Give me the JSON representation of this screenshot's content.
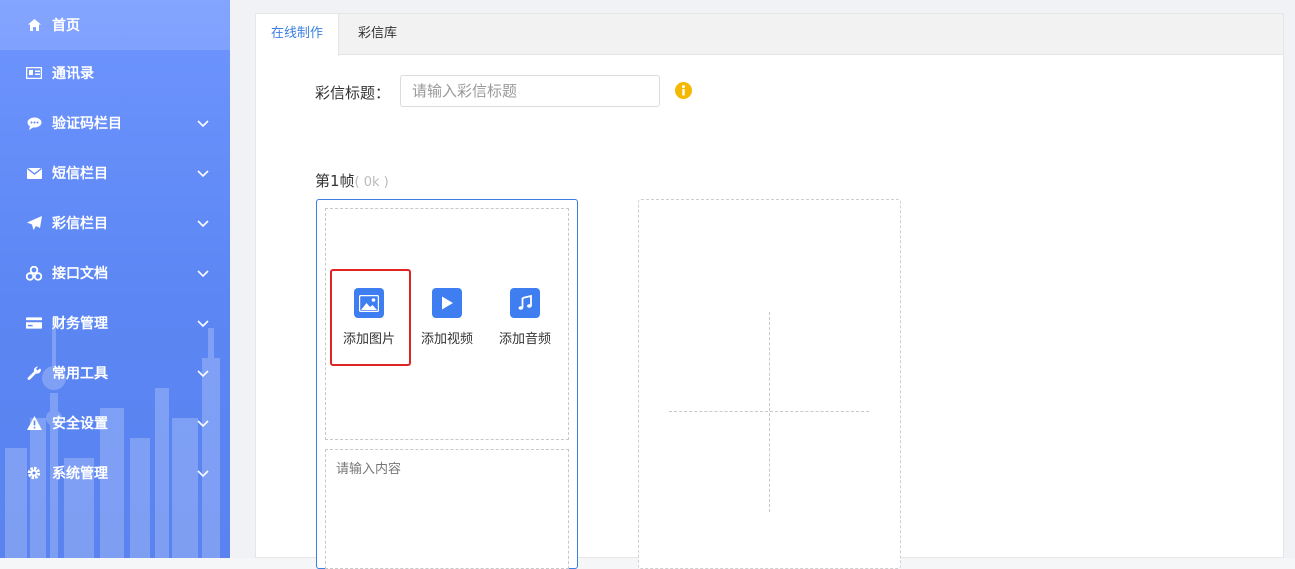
{
  "sidebar": {
    "items": [
      {
        "label": "首页",
        "icon": "home-icon",
        "expandable": false,
        "active": true
      },
      {
        "label": "通讯录",
        "icon": "contact-card-icon",
        "expandable": false
      },
      {
        "label": "验证码栏目",
        "icon": "chat-bubble-icon",
        "expandable": true
      },
      {
        "label": "短信栏目",
        "icon": "envelope-icon",
        "expandable": true
      },
      {
        "label": "彩信栏目",
        "icon": "paper-plane-icon",
        "expandable": true
      },
      {
        "label": "接口文档",
        "icon": "api-cubes-icon",
        "expandable": true
      },
      {
        "label": "财务管理",
        "icon": "credit-card-icon",
        "expandable": true
      },
      {
        "label": "常用工具",
        "icon": "wrench-icon",
        "expandable": true
      },
      {
        "label": "安全设置",
        "icon": "warning-icon",
        "expandable": true
      },
      {
        "label": "系统管理",
        "icon": "gear-icon",
        "expandable": true
      }
    ]
  },
  "tabs": [
    {
      "label": "在线制作",
      "active": true
    },
    {
      "label": "彩信库",
      "active": false
    }
  ],
  "form": {
    "title_label": "彩信标题：",
    "title_placeholder": "请输入彩信标题",
    "title_value": ""
  },
  "frame": {
    "label": "第1帧",
    "size": "( 0k )",
    "add_image": "添加图片",
    "add_video": "添加视频",
    "add_audio": "添加音频",
    "content_placeholder": "请输入内容"
  },
  "colors": {
    "accent": "#3b7fe0",
    "sidebar": "#5b86f3",
    "media_icon": "#3f7ef0",
    "highlight": "#e02424",
    "info": "#f5b800"
  }
}
